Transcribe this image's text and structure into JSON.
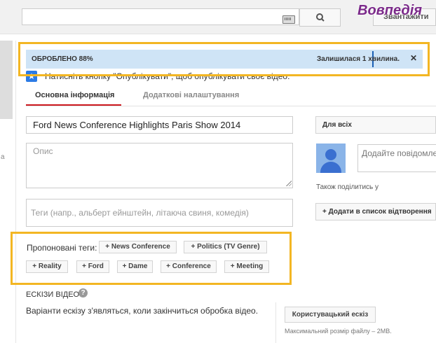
{
  "header": {
    "search_value": "",
    "sign_in_label": "Звантажити",
    "watermark": "Вовпедія"
  },
  "left_panel": {
    "letter": "а"
  },
  "progress": {
    "status": "ОБРОБЛЕНО 88%",
    "percent": 88,
    "remaining": "Залишилася 1 хвилина.",
    "close_symbol": "✕"
  },
  "hint": {
    "icon_symbol": "★",
    "text": "Натисніть кнопку \"Опублікувати\", щоб опублікувати своє відео."
  },
  "tabs": [
    {
      "label": "Основна інформація",
      "active": true
    },
    {
      "label": "Додаткові налаштування",
      "active": false
    }
  ],
  "form": {
    "title_value": "Ford News Conference Highlights  Paris Show 2014",
    "description_placeholder": "Опис",
    "tags_placeholder": "Теги (напр., альберт ейнштейн, літаюча свиня, комедія)"
  },
  "suggested": {
    "label": "Пропоновані теги:",
    "tags": [
      "+ News Conference",
      "+ Politics (TV Genre)",
      "+ Reality",
      "+ Ford",
      "+ Dame",
      "+ Conference",
      "+ Meeting"
    ]
  },
  "thumbnails": {
    "title": "ЕСКІЗИ ВІДЕО",
    "help_symbol": "?",
    "text": "Варіанти ескізу з'являться, коли закінчиться обробка відео.",
    "custom_button": "Користувацький ескіз",
    "max_size": "Максимальний розмір файлу – 2MB."
  },
  "sidebar": {
    "privacy_label": "Для всіх",
    "comment_placeholder": "Додайте повідомлення",
    "share_label": "Також поділитись у",
    "add_to_playlist": "+ Додати в список відтворення"
  },
  "colors": {
    "highlight": "#f3b623",
    "progress_bg": "#cfe4f6",
    "active_tab": "#cc181e",
    "watermark": "#7b2a8a"
  }
}
